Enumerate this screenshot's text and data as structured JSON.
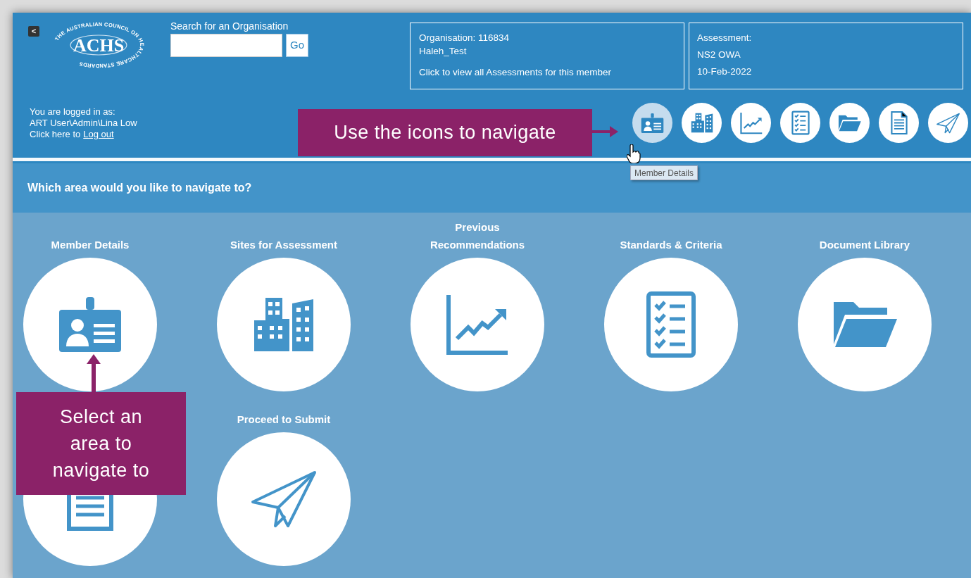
{
  "header": {
    "back_button": "<",
    "logo": {
      "text": "ACHS",
      "ring_text": "THE AUSTRALIAN COUNCIL ON HEALTHCARE STANDARDS"
    },
    "search": {
      "label": "Search for an Organisation",
      "button": "Go"
    },
    "organisation": {
      "line_1": "Organisation: 116834",
      "line_2": "Haleh_Test",
      "link": "Click to view all Assessments for this member"
    },
    "assessment": {
      "line_1": "Assessment:",
      "line_2": "NS2 OWA",
      "line_3": "10-Feb-2022"
    },
    "login": {
      "line_1": "You are logged in as:",
      "line_2": "ART User\\Admin\\Lina Low",
      "line_3_prefix": "Click here to",
      "logout_link": "Log out"
    },
    "nav_icons": [
      {
        "kind": "id-card",
        "selected": true
      },
      {
        "kind": "buildings",
        "selected": false
      },
      {
        "kind": "chart",
        "selected": false
      },
      {
        "kind": "checklist",
        "selected": false
      },
      {
        "kind": "folder",
        "selected": false
      },
      {
        "kind": "document",
        "selected": false
      },
      {
        "kind": "plane",
        "selected": false
      }
    ],
    "tooltip": "Member Details"
  },
  "prompt": "Which area would you like to navigate to?",
  "tiles": [
    {
      "title": "Member Details",
      "kind": "id-card"
    },
    {
      "title": "Sites for Assessment",
      "kind": "buildings"
    },
    {
      "title": "Previous Recommendations",
      "kind": "chart"
    },
    {
      "title": "Standards & Criteria",
      "kind": "checklist"
    },
    {
      "title": "Document Library",
      "kind": "folder"
    },
    {
      "kind": "document"
    },
    {
      "title": "Proceed to Submit",
      "kind": "plane"
    }
  ],
  "callouts": [
    {
      "text": "Use the icons to navigate"
    },
    {
      "text": "Select an area to navigate to"
    }
  ]
}
